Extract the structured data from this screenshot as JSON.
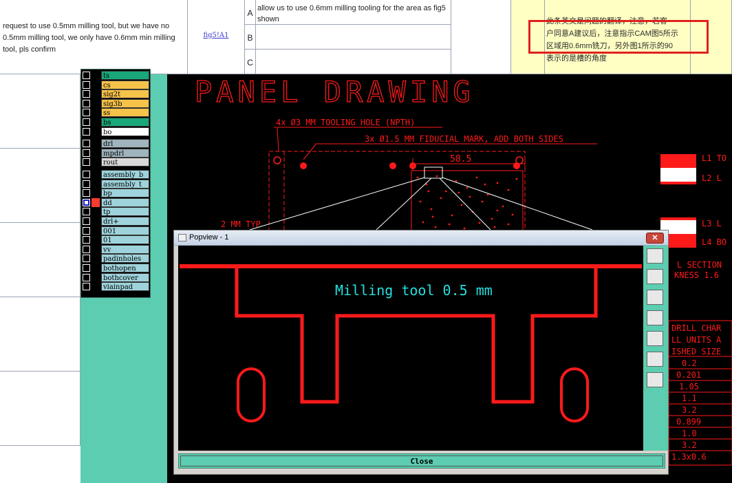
{
  "spreadsheet": {
    "request_text": "request to use 0.5mm milling tool, but we have no 0.5mm milling tool, we only have 0.6mm min milling tool, pls confirm",
    "ref_link": "fig5!A1",
    "options": [
      {
        "letter": "A",
        "text": "allow us to use 0.6mm milling tooling for the area as fig5 shown"
      },
      {
        "letter": "B",
        "text": ""
      },
      {
        "letter": "C",
        "text": ""
      }
    ],
    "remark_lines": [
      "此条英文是问题的翻译，注意，若客",
      "户同意A建议后，注意指示CAM图5所示",
      "区域用0.6mm铣刀，另外图1所示的90",
      "表示的是槽的角度"
    ]
  },
  "layers": [
    {
      "name": "ts",
      "color": "#1aa77a"
    },
    {
      "name": "cs",
      "color": "#f5c24a"
    },
    {
      "name": "sig2t",
      "color": "#f5c24a"
    },
    {
      "name": "sig3b",
      "color": "#f5c24a"
    },
    {
      "name": "ss",
      "color": "#f5c24a"
    },
    {
      "name": "bs",
      "color": "#1aa77a"
    },
    {
      "name": "bo",
      "color": "#ffffff"
    },
    {
      "name": "drl",
      "color": "#9fb4bd"
    },
    {
      "name": "mpdrl",
      "color": "#9fb4bd"
    },
    {
      "name": "rout",
      "color": "#d8d8d8"
    },
    {
      "name": "assembly_b",
      "color": "#9fd3dc"
    },
    {
      "name": "assembly_t",
      "color": "#9fd3dc"
    },
    {
      "name": "bp",
      "color": "#9fd3dc"
    },
    {
      "name": "dd",
      "color": "#9fd3dc"
    },
    {
      "name": "tp",
      "color": "#9fd3dc"
    },
    {
      "name": "drl+",
      "color": "#9fd3dc"
    },
    {
      "name": "001",
      "color": "#9fd3dc"
    },
    {
      "name": "01",
      "color": "#9fd3dc"
    },
    {
      "name": "vv",
      "color": "#9fd3dc"
    },
    {
      "name": "padinholes",
      "color": "#9fd3dc"
    },
    {
      "name": "bothopen",
      "color": "#9fd3dc"
    },
    {
      "name": "bothcover",
      "color": "#9fd3dc"
    },
    {
      "name": "viainpad",
      "color": "#9fd3dc"
    }
  ],
  "drawing": {
    "title": "PANEL DRAWING",
    "note_tooling": "4x Ø3 MM TOOLING HOLE (NPTH)",
    "note_fiducial": "3x Ø1.5 MM FIDUCIAL MARK, ADD BOTH SIDES",
    "dim_width": "58.5",
    "dim_2mm": "2 MM TYP",
    "layer_labels": [
      "L1 TO",
      "L2 L",
      "L3 L",
      "L4 BO"
    ],
    "section_labels": [
      "L SECTION",
      "KNESS 1.6"
    ],
    "drill_header": [
      "DRILL CHAR",
      "LL UNITS A",
      "ISHED SIZE"
    ],
    "drill_values": [
      "0.2",
      "0.201",
      "1.05",
      "1.1",
      "3.2",
      "0.899",
      "1.0",
      "3.2",
      "1.3x0.6"
    ]
  },
  "popview": {
    "title": "Popview - 1",
    "label": "Milling tool 0.5 mm",
    "close_label": "Close"
  },
  "colors": {
    "cad_red": "#ff1a1a",
    "cad_bg": "#000000",
    "teal": "#5ccdb0",
    "highlight": "#ffffc4",
    "label_cyan": "#22e0e0"
  }
}
